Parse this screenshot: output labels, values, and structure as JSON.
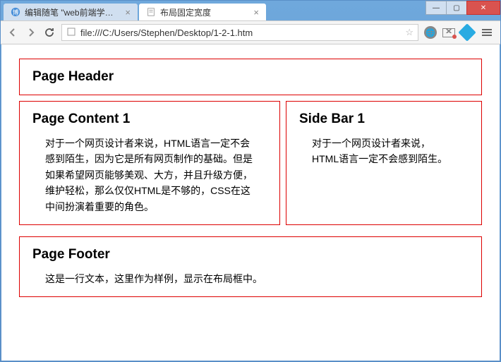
{
  "window": {
    "tabs": [
      {
        "title": "编辑随笔 \"web前端学习笔",
        "active": false
      },
      {
        "title": "布局固定宽度",
        "active": true
      }
    ],
    "controls": {
      "min": "—",
      "max": "▢",
      "close": "✕"
    }
  },
  "toolbar": {
    "url": "file:///C:/Users/Stephen/Desktop/1-2-1.htm"
  },
  "page": {
    "header": {
      "title": "Page Header"
    },
    "content1": {
      "title": "Page Content 1",
      "body": "对于一个网页设计者来说，HTML语言一定不会感到陌生，因为它是所有网页制作的基础。但是如果希望网页能够美观、大方，并且升级方便，维护轻松，那么仅仅HTML是不够的，CSS在这中间扮演着重要的角色。"
    },
    "sidebar1": {
      "title": "Side Bar 1",
      "body": "对于一个网页设计者来说，HTML语言一定不会感到陌生。"
    },
    "footer": {
      "title": "Page Footer",
      "body": "这是一行文本，这里作为样例，显示在布局框中。"
    }
  }
}
